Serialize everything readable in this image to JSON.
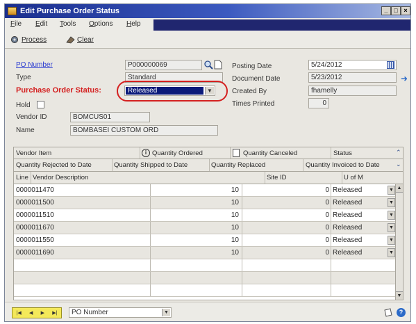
{
  "window": {
    "title": "Edit Purchase Order Status"
  },
  "menu": [
    "File",
    "Edit",
    "Tools",
    "Options",
    "Help"
  ],
  "toolbar": {
    "process": "Process",
    "clear": "Clear"
  },
  "header": {
    "po_number_label": "PO Number",
    "po_number": "P000000069",
    "type_label": "Type",
    "type": "Standard",
    "status_label": "Purchase Order Status:",
    "status": "Released",
    "hold_label": "Hold",
    "vendor_id_label": "Vendor ID",
    "vendor_id": "BOMCUS01",
    "name_label": "Name",
    "name": "BOMBASEI CUSTOM ORD",
    "posting_date_label": "Posting Date",
    "posting_date": "5/24/2012",
    "document_date_label": "Document Date",
    "document_date": "5/23/2012",
    "created_by_label": "Created By",
    "created_by": "fhamelly",
    "times_printed_label": "Times Printed",
    "times_printed": "0"
  },
  "grid": {
    "header1": {
      "vendor_item": "Vendor Item",
      "qty_ordered": "Quantity Ordered",
      "qty_canceled": "Quantity Canceled",
      "status": "Status"
    },
    "header2": {
      "rejected": "Quantity Rejected to Date",
      "shipped": "Quantity Shipped to Date",
      "replaced": "Quantity Replaced",
      "invoiced": "Quantity Invoiced to Date"
    },
    "header3": {
      "line": "Line",
      "vendor_desc": "Vendor Description",
      "site_id": "Site ID",
      "uom": "U of M"
    },
    "rows": [
      {
        "item": "0000011470",
        "ordered": "10",
        "canceled": "0",
        "status": "Released"
      },
      {
        "item": "0000011500",
        "ordered": "10",
        "canceled": "0",
        "status": "Released"
      },
      {
        "item": "0000011510",
        "ordered": "10",
        "canceled": "0",
        "status": "Released"
      },
      {
        "item": "0000011670",
        "ordered": "10",
        "canceled": "0",
        "status": "Released"
      },
      {
        "item": "0000011550",
        "ordered": "10",
        "canceled": "0",
        "status": "Released"
      },
      {
        "item": "0000011690",
        "ordered": "10",
        "canceled": "0",
        "status": "Released"
      }
    ]
  },
  "statusbar": {
    "sort_by": "PO Number"
  },
  "colors": {
    "title_bar": "#1a2e8e",
    "status_label": "#d42020",
    "highlight_oval": "#d42020",
    "selected_status": "#0a1a7a"
  }
}
